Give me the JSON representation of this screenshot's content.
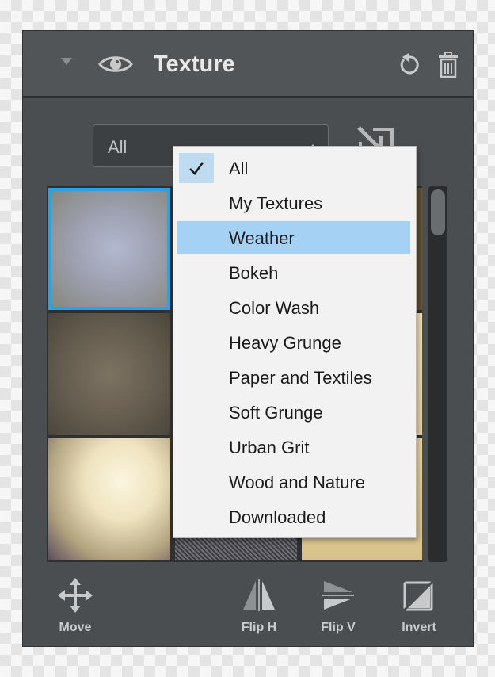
{
  "panel": {
    "title": "Texture"
  },
  "filter": {
    "selected": "All",
    "options": [
      {
        "label": "All",
        "checked": true
      },
      {
        "label": "My Textures"
      },
      {
        "label": "Weather",
        "highlighted": true
      },
      {
        "label": "Bokeh"
      },
      {
        "label": "Color Wash"
      },
      {
        "label": "Heavy Grunge"
      },
      {
        "label": "Paper and Textiles"
      },
      {
        "label": "Soft Grunge"
      },
      {
        "label": "Urban Grit"
      },
      {
        "label": "Wood and Nature"
      },
      {
        "label": "Downloaded"
      }
    ]
  },
  "toolbar": {
    "move_label": "Move",
    "flip_h_label": "Flip H",
    "flip_v_label": "Flip V",
    "invert_label": "Invert"
  },
  "icons": {
    "visibility": "eye-icon",
    "reset": "reset-icon",
    "delete": "trash-icon",
    "import": "import-icon",
    "move": "move-icon",
    "flip_h": "flip-horizontal-icon",
    "flip_v": "flip-vertical-icon",
    "invert": "invert-icon"
  },
  "colors": {
    "selection_border": "#27a4e8",
    "menu_highlight": "#a4d1f4",
    "panel_bg": "#4b4e50"
  }
}
